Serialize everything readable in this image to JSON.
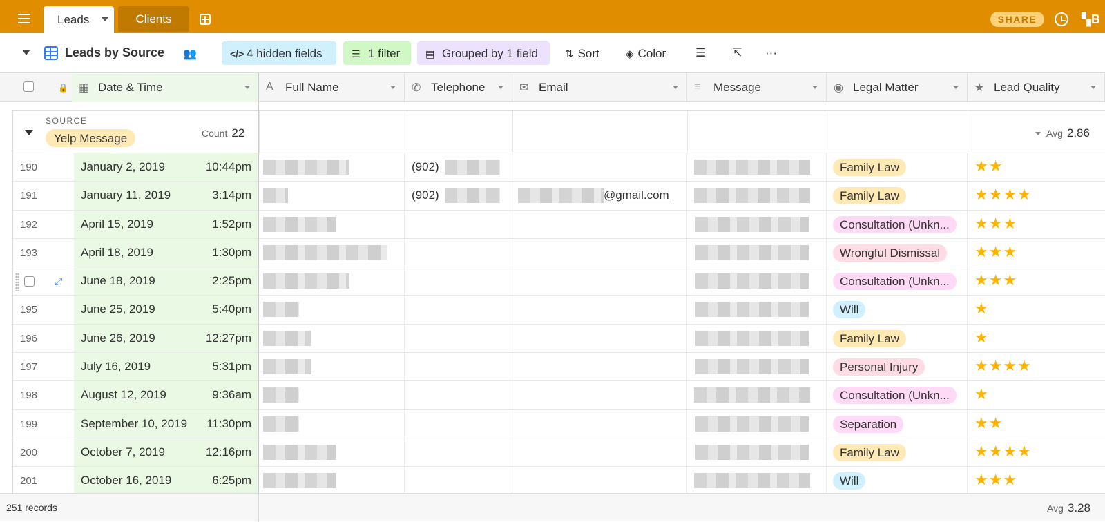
{
  "topbar": {
    "tabs": [
      {
        "label": "Leads",
        "active": true
      },
      {
        "label": "Clients",
        "active": false
      }
    ],
    "share_label": "SHARE",
    "apps_label": "B",
    "color": "#e08d00"
  },
  "toolbar": {
    "view_name": "Leads by Source",
    "hidden_fields": "4 hidden fields",
    "filter": "1 filter",
    "grouped": "Grouped by 1 field",
    "sort": "Sort",
    "color": "Color"
  },
  "columns": {
    "date": "Date & Time",
    "name": "Full Name",
    "telephone": "Telephone",
    "email": "Email",
    "message": "Message",
    "legal": "Legal Matter",
    "quality": "Lead Quality"
  },
  "group": {
    "label": "SOURCE",
    "value": "Yelp Message",
    "count_label": "Count",
    "count": "22",
    "avg_label": "Avg",
    "avg": "2.86"
  },
  "rows": [
    {
      "num": "190",
      "date": "January 2, 2019",
      "time": "10:44pm",
      "tel": "(902)",
      "email": "",
      "legal": "Family Law",
      "legal_color": "#ffeab6",
      "stars": 2
    },
    {
      "num": "191",
      "date": "January 11, 2019",
      "time": "3:14pm",
      "tel": "(902)",
      "email": "@gmail.com",
      "legal": "Family Law",
      "legal_color": "#ffeab6",
      "stars": 4
    },
    {
      "num": "192",
      "date": "April 15, 2019",
      "time": "1:52pm",
      "tel": "",
      "email": "",
      "legal": "Consultation (Unkn...",
      "legal_color": "#ffdaf6",
      "stars": 3
    },
    {
      "num": "193",
      "date": "April 18, 2019",
      "time": "1:30pm",
      "tel": "",
      "email": "",
      "legal": "Wrongful Dismissal",
      "legal_color": "#ffdce5",
      "stars": 3
    },
    {
      "num": "",
      "date": "June 18, 2019",
      "time": "2:25pm",
      "tel": "",
      "email": "",
      "legal": "Consultation (Unkn...",
      "legal_color": "#ffdaf6",
      "stars": 3
    },
    {
      "num": "195",
      "date": "June 25, 2019",
      "time": "5:40pm",
      "tel": "",
      "email": "",
      "legal": "Will",
      "legal_color": "#d0f0fd",
      "stars": 1
    },
    {
      "num": "196",
      "date": "June 26, 2019",
      "time": "12:27pm",
      "tel": "",
      "email": "",
      "legal": "Family Law",
      "legal_color": "#ffeab6",
      "stars": 1
    },
    {
      "num": "197",
      "date": "July 16, 2019",
      "time": "5:31pm",
      "tel": "",
      "email": "",
      "legal": "Personal Injury",
      "legal_color": "#ffdce5",
      "stars": 4
    },
    {
      "num": "198",
      "date": "August 12, 2019",
      "time": "9:36am",
      "tel": "",
      "email": "",
      "legal": "Consultation (Unkn...",
      "legal_color": "#ffdaf6",
      "stars": 1
    },
    {
      "num": "199",
      "date": "September 10, 2019",
      "time": "11:30pm",
      "tel": "",
      "email": "",
      "legal": "Separation",
      "legal_color": "#ffdaf6",
      "stars": 2
    },
    {
      "num": "200",
      "date": "October 7, 2019",
      "time": "12:16pm",
      "tel": "",
      "email": "",
      "legal": "Family Law",
      "legal_color": "#ffeab6",
      "stars": 4
    },
    {
      "num": "201",
      "date": "October 16, 2019",
      "time": "6:25pm",
      "tel": "",
      "email": "",
      "legal": "Will",
      "legal_color": "#d0f0fd",
      "stars": 3
    }
  ],
  "footer": {
    "records": "251 records",
    "avg_label": "Avg",
    "avg": "3.28"
  }
}
